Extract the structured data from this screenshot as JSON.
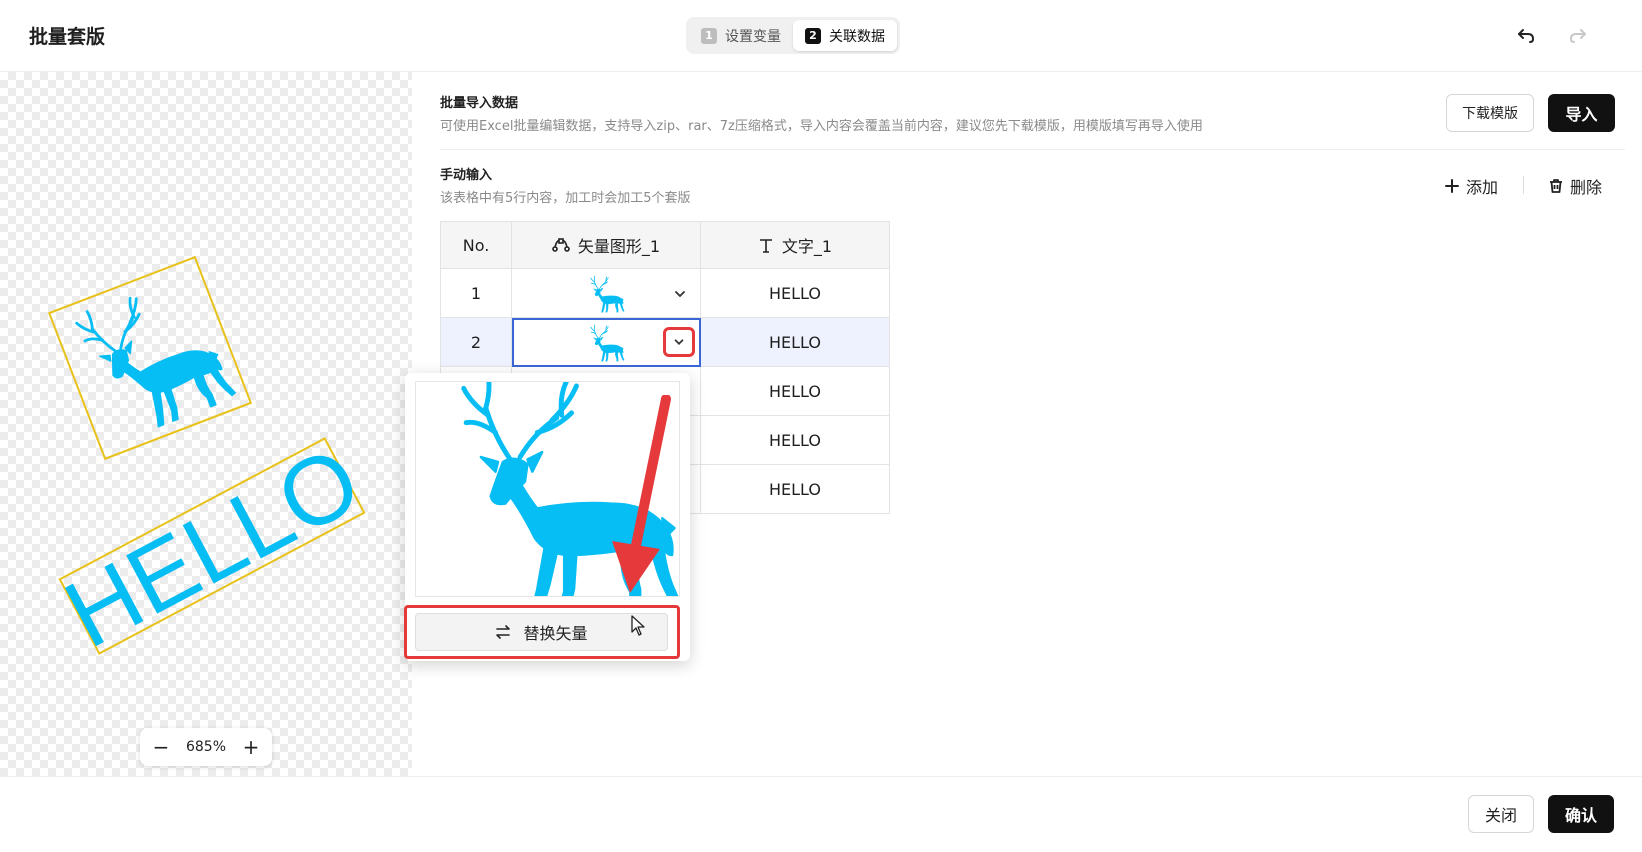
{
  "header": {
    "title": "批量套版",
    "steps": [
      {
        "num": "1",
        "label": "设置变量"
      },
      {
        "num": "2",
        "label": "关联数据"
      }
    ]
  },
  "canvas": {
    "text": "HELLO",
    "zoom_level": "685%",
    "zoom_out": "−",
    "zoom_in": "+"
  },
  "batch_import": {
    "title": "批量导入数据",
    "description": "可使用Excel批量编辑数据，支持导入zip、rar、7z压缩格式，导入内容会覆盖当前内容，建议您先下载模版，用模版填写再导入使用",
    "download_label": "下载模版",
    "import_label": "导入"
  },
  "manual_input": {
    "title": "手动输入",
    "description": "该表格中有5行内容，加工时会加工5个套版",
    "add_label": "添加",
    "delete_label": "删除"
  },
  "table": {
    "columns": [
      "No.",
      "矢量图形_1",
      "文字_1"
    ],
    "rows": [
      {
        "no": "1",
        "text": "HELLO"
      },
      {
        "no": "2",
        "text": "HELLO"
      },
      {
        "no": "",
        "text": "HELLO"
      },
      {
        "no": "",
        "text": "HELLO"
      },
      {
        "no": "",
        "text": "HELLO"
      }
    ]
  },
  "popover": {
    "replace_label": "替换矢量"
  },
  "footer": {
    "close_label": "关闭",
    "confirm_label": "确认"
  },
  "colors": {
    "accent_dark": "#111111",
    "deer_blue": "#06bdf4",
    "highlight_red": "#e5393b",
    "selection_blue": "#3b67d6",
    "bbox_yellow": "#e8c21a"
  },
  "icons": [
    "undo-icon",
    "redo-icon",
    "vector-icon",
    "text-icon",
    "plus-icon",
    "trash-icon",
    "chevron-down-icon",
    "swap-icon",
    "cursor-icon"
  ]
}
